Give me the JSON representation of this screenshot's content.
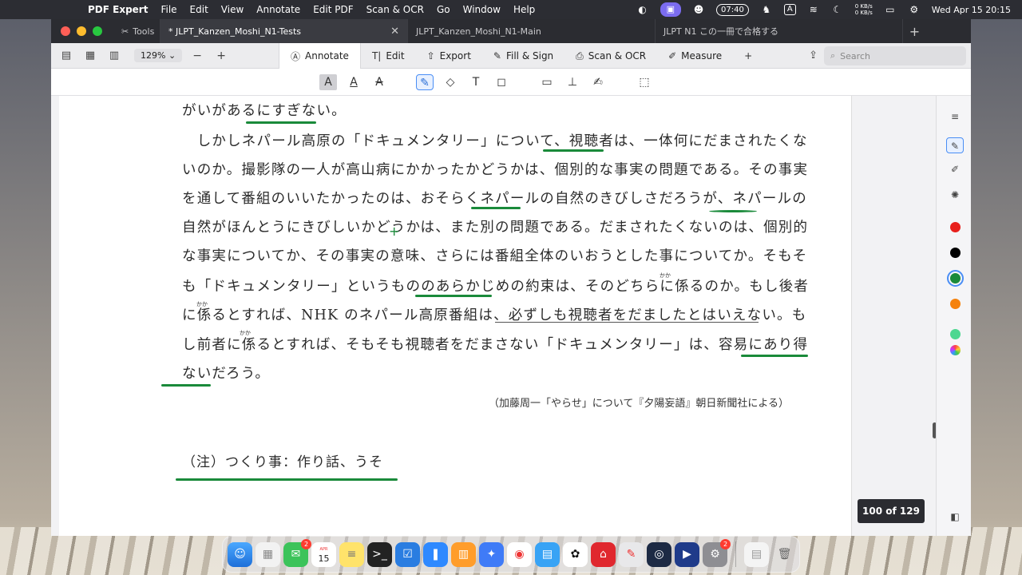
{
  "menubar": {
    "app_name": "PDF Expert",
    "menus": [
      "File",
      "Edit",
      "View",
      "Annotate",
      "Edit PDF",
      "Scan & OCR",
      "Go",
      "Window",
      "Help"
    ],
    "timer": "07:40",
    "input_source": "A",
    "net_up": "0 KB/s",
    "net_down": "0 KB/s",
    "datetime": "Wed Apr 15  20:15"
  },
  "tabs": {
    "tools_label": "Tools",
    "active_label": "* JLPT_Kanzen_Moshi_N1-Tests",
    "tab2_label": "JLPT_Kanzen_Moshi_N1-Main",
    "tab3_label": "JLPT N1 この一冊で合格する"
  },
  "toolbar": {
    "zoom": "129%",
    "modes": [
      "Annotate",
      "Edit",
      "Export",
      "Fill & Sign",
      "Scan & OCR",
      "Measure"
    ],
    "search_placeholder": "Search"
  },
  "document": {
    "lines": [
      "がいがあるにすぎない。",
      "　しかしネパール高原の「ドキュメンタリー」について、視聴者は、一体何にだまされたくな",
      "いのか。撮影隊の一人が高山病にかかったかどうかは、個別的な事実の問題である。その事実",
      "を通して番組のいいたかったのは、おそらくネパールの自然のきびしさだろうが、ネパールの",
      "自然がほんとうにきびしいかどうかは、また別の問題である。だまされたくないのは、個別的",
      "な事実についてか、その事実の意味、さらには番組全体のいおうとした事についてか。そもそ",
      "も「ドキュメンタリー」というもののあらかじめの約束は、そのどちらに係るのか。もし後者",
      "に係るとすれば、NHK のネパール高原番組は、必ずしも視聴者をだましたとはいえない。も",
      "し前者に係るとすれば、そもそも視聴者をだまさない「ドキュメンタリー」は、容易にあり得",
      "ないだろう。"
    ],
    "ruby": [
      "かか",
      "かか",
      "かか"
    ],
    "source": "（加藤周一「やらせ」について『夕陽妄語』朝日新聞社による）",
    "note": "（注）つくり事：作り話、うそ"
  },
  "page_indicator": "100 of 129",
  "colors": {
    "annotation_green": "#1a8a3a",
    "swatches": [
      "#e8201c",
      "#000000",
      "#1a8a3a",
      "#f5820d",
      "#4cd790"
    ]
  },
  "dock": {
    "badges": [
      "2",
      "2"
    ],
    "calendar_day": "15",
    "calendar_month": "APR"
  }
}
